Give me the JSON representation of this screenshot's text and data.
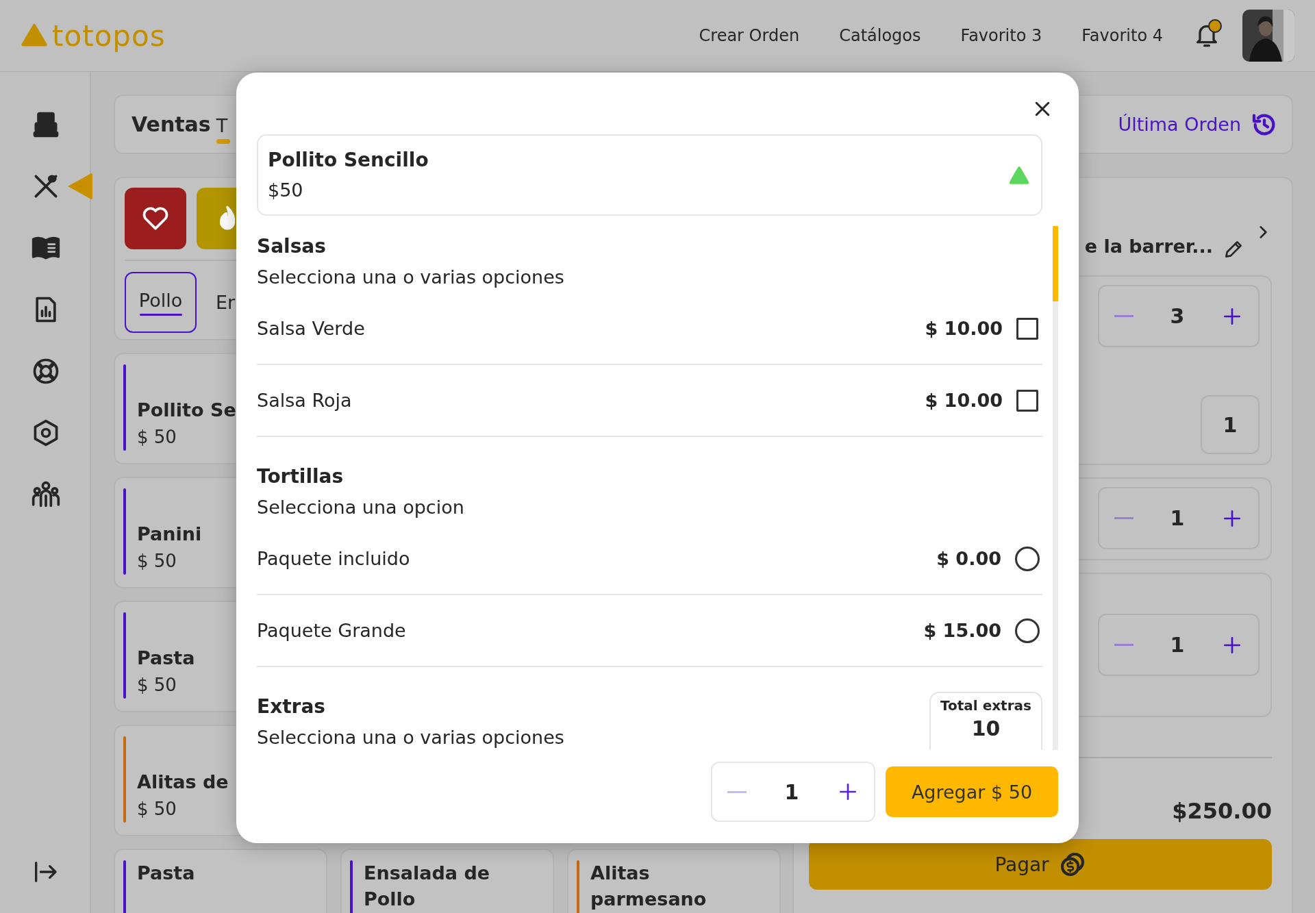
{
  "topbar": {
    "logo": "totopos",
    "nav": [
      "Crear Orden",
      "Catálogos",
      "Favorito 3",
      "Favorito 4"
    ],
    "notifications": {
      "unread": true
    },
    "avatar": {
      "kind": "picture"
    }
  },
  "sidebar": {
    "items": [
      {
        "selected": false
      },
      {
        "selected": true
      },
      {
        "selected": false
      },
      {
        "selected": false
      },
      {
        "selected": false
      },
      {
        "selected": false
      },
      {
        "selected": false
      }
    ]
  },
  "header": {
    "title": "Ventas",
    "tabs": [
      {
        "label": "T",
        "selected": true
      }
    ],
    "last_order": "Última Orden"
  },
  "favorites": [
    {
      "color": "#9b1d1d"
    },
    {
      "color": "#b39500"
    }
  ],
  "categories": [
    {
      "label": "Pollo",
      "selected": true
    },
    {
      "label": "Er",
      "selected": false
    }
  ],
  "products": [
    [
      {
        "name": "Pollito Se",
        "price": "$ 50",
        "color": "#4a12c8"
      }
    ],
    [
      {
        "name": "Panini",
        "price": "$ 50",
        "color": "#4a12c8"
      }
    ],
    [
      {
        "name": "Pasta",
        "price": "$ 50",
        "color": "#4a12c8"
      }
    ],
    [
      {
        "name": "Alitas de",
        "price": "$ 50",
        "color": "#c46a10"
      }
    ],
    [
      {
        "name": "Pasta",
        "color": "#4a12c8"
      },
      {
        "name": "Ensalada de Pollo",
        "color": "#4a12c8"
      },
      {
        "name": "Alitas parmesano",
        "color": "#c46a10"
      }
    ]
  ],
  "order": {
    "customer": "e la barrer...",
    "items": [
      {
        "quantity": "3",
        "extra_quantity": "1"
      },
      {
        "quantity": "1"
      },
      {
        "quantity": "1"
      }
    ],
    "total": "$250.00",
    "pay_label": "Pagar"
  },
  "modal": {
    "product": {
      "name": "Pollito Sencillo",
      "price": "$50"
    },
    "groups": [
      {
        "title": "Salsas",
        "subtitle": "Selecciona una o varias opciones",
        "kind": "checkbox",
        "options": [
          {
            "label": "Salsa Verde",
            "price": "$ 10.00",
            "checked": false
          },
          {
            "label": "Salsa Roja",
            "price": "$ 10.00",
            "checked": false
          }
        ]
      },
      {
        "title": "Tortillas",
        "subtitle": "Selecciona una opcion",
        "kind": "radio",
        "options": [
          {
            "label": "Paquete incluido",
            "price": "$ 0.00",
            "selected": false
          },
          {
            "label": "Paquete Grande",
            "price": "$ 15.00",
            "selected": false
          }
        ]
      },
      {
        "title": "Extras",
        "subtitle": "Selecciona una o varias opciones",
        "total_label": "Total extras",
        "total_value": "10"
      }
    ],
    "quantity": "1",
    "add_label": "Agregar $ 50"
  }
}
